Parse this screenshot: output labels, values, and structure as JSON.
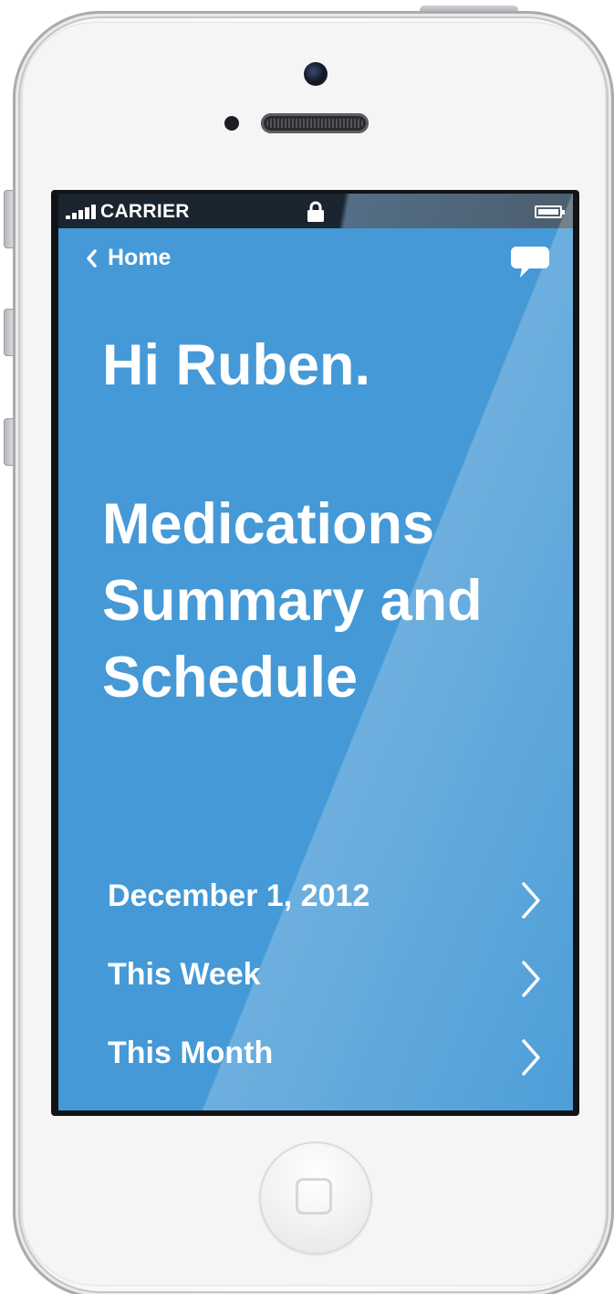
{
  "status_bar": {
    "carrier": "CARRIER",
    "signal_icon": "signal-bars-icon",
    "lock_icon": "lock-icon",
    "battery_icon": "battery-icon"
  },
  "nav": {
    "back_label": "Home",
    "back_icon": "chevron-left-icon",
    "chat_icon": "speech-bubble-icon"
  },
  "greeting": "Hi Ruben.",
  "title_lines": [
    "Medications",
    "Summary and",
    "Schedule"
  ],
  "menu": [
    {
      "label": "December 1, 2012",
      "icon": "chevron-right-icon"
    },
    {
      "label": "This Week",
      "icon": "chevron-right-icon"
    },
    {
      "label": "This Month",
      "icon": "chevron-right-icon"
    }
  ],
  "colors": {
    "screen_background": "#4499d6",
    "status_bar": "#1a2530",
    "text": "#ffffff"
  }
}
